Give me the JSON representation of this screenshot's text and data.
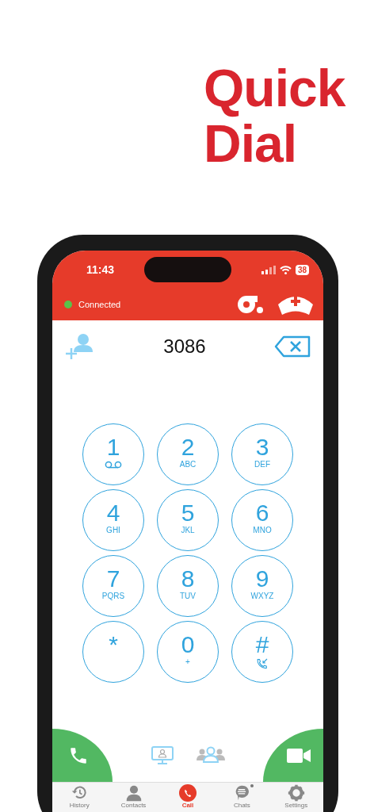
{
  "headline": [
    "Quick",
    "Dial"
  ],
  "status_bar": {
    "time": "11:43",
    "battery": "38"
  },
  "connection": {
    "label": "Connected",
    "color": "#5ac24a"
  },
  "dialed_number": "3086",
  "keypad": [
    {
      "key": "1",
      "kind": "voicemail"
    },
    {
      "key": "2",
      "kind": "letters",
      "letters": "ABC"
    },
    {
      "key": "3",
      "kind": "letters",
      "letters": "DEF"
    },
    {
      "key": "4",
      "kind": "letters",
      "letters": "GHI"
    },
    {
      "key": "5",
      "kind": "letters",
      "letters": "JKL"
    },
    {
      "key": "6",
      "kind": "letters",
      "letters": "MNO"
    },
    {
      "key": "7",
      "kind": "letters",
      "letters": "PQRS"
    },
    {
      "key": "8",
      "kind": "letters",
      "letters": "TUV"
    },
    {
      "key": "9",
      "kind": "letters",
      "letters": "WXYZ"
    },
    {
      "key": "*",
      "kind": "plain"
    },
    {
      "key": "0",
      "kind": "letters",
      "letters": "+"
    },
    {
      "key": "#",
      "kind": "transfer"
    }
  ],
  "tabs": [
    {
      "label": "History",
      "selected": false,
      "unread": false
    },
    {
      "label": "Contacts",
      "selected": false,
      "unread": false
    },
    {
      "label": "Call",
      "selected": true,
      "unread": false
    },
    {
      "label": "Chats",
      "selected": false,
      "unread": true
    },
    {
      "label": "Settings",
      "selected": false,
      "unread": false
    }
  ]
}
